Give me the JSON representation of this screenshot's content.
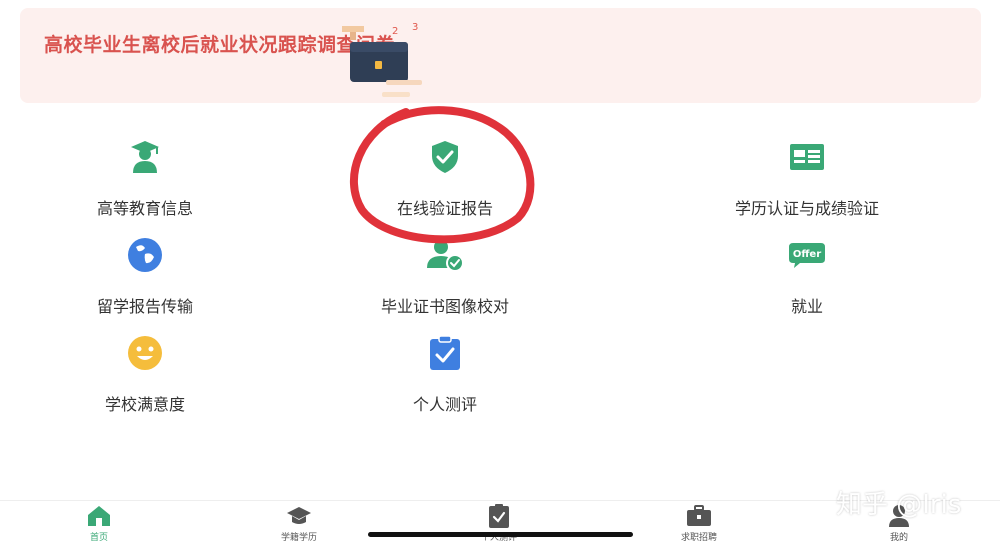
{
  "banner": {
    "title": "高校毕业生离校后就业状况跟踪调查问卷"
  },
  "tiles": [
    {
      "label": "高等教育信息",
      "icon": "graduate-person-icon"
    },
    {
      "label": "在线验证报告",
      "icon": "shield-check-icon"
    },
    {
      "label": "学历认证与成绩验证",
      "icon": "id-card-icon"
    },
    {
      "label": "留学报告传输",
      "icon": "globe-icon"
    },
    {
      "label": "毕业证书图像校对",
      "icon": "person-check-icon"
    },
    {
      "label": "就业",
      "icon": "offer-badge-icon",
      "badge": "Offer"
    },
    {
      "label": "学校满意度",
      "icon": "smiley-icon"
    },
    {
      "label": "个人测评",
      "icon": "clipboard-check-icon"
    }
  ],
  "tabbar": [
    {
      "label": "首页",
      "icon": "home-icon",
      "active": true
    },
    {
      "label": "学籍学历",
      "icon": "graduation-cap-icon"
    },
    {
      "label": "个人测评",
      "icon": "clipboard-check-icon"
    },
    {
      "label": "求职招聘",
      "icon": "briefcase-icon"
    },
    {
      "label": "我的",
      "icon": "user-icon"
    }
  ],
  "watermark": "知乎 @Iris",
  "colors": {
    "accent_green": "#3aa876",
    "banner_bg": "#fdf0ee",
    "banner_text": "#d9534f",
    "annotation_red": "#e0323a"
  }
}
